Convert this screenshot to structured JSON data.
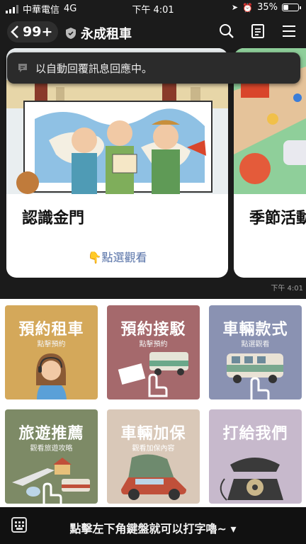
{
  "status_bar": {
    "carrier": "中華電信",
    "network": "4G",
    "time": "下午 4:01",
    "battery": "35%",
    "battery_level": 0.35
  },
  "header": {
    "unread_count": "99+",
    "chat_title": "永成租車"
  },
  "toast": {
    "text": "以自動回覆訊息回應中。"
  },
  "carousel": {
    "cards": [
      {
        "name": "認識金門",
        "cta": "👇點選觀看"
      },
      {
        "name": "季節活動",
        "cta": ""
      }
    ],
    "timestamp": "下午 4:01"
  },
  "menu": {
    "tiles": [
      {
        "title": "預約租車",
        "subtitle": "點擊預約",
        "color": "#d4a85a"
      },
      {
        "title": "預約接駁",
        "subtitle": "點擊預約",
        "color": "#a5696c"
      },
      {
        "title": "車輛款式",
        "subtitle": "點選觀看",
        "color": "#8a92b2"
      },
      {
        "title": "旅遊推薦",
        "subtitle": "觀看旅遊攻略",
        "color": "#7d8a66"
      },
      {
        "title": "車輛加保",
        "subtitle": "觀看加保內容",
        "color": "#d9c8b8"
      },
      {
        "title": "打給我們",
        "subtitle": "",
        "color": "#c7b9cc"
      }
    ]
  },
  "bottom_bar": {
    "text": "點擊左下角鍵盤就可以打字嚕~ ▾"
  }
}
